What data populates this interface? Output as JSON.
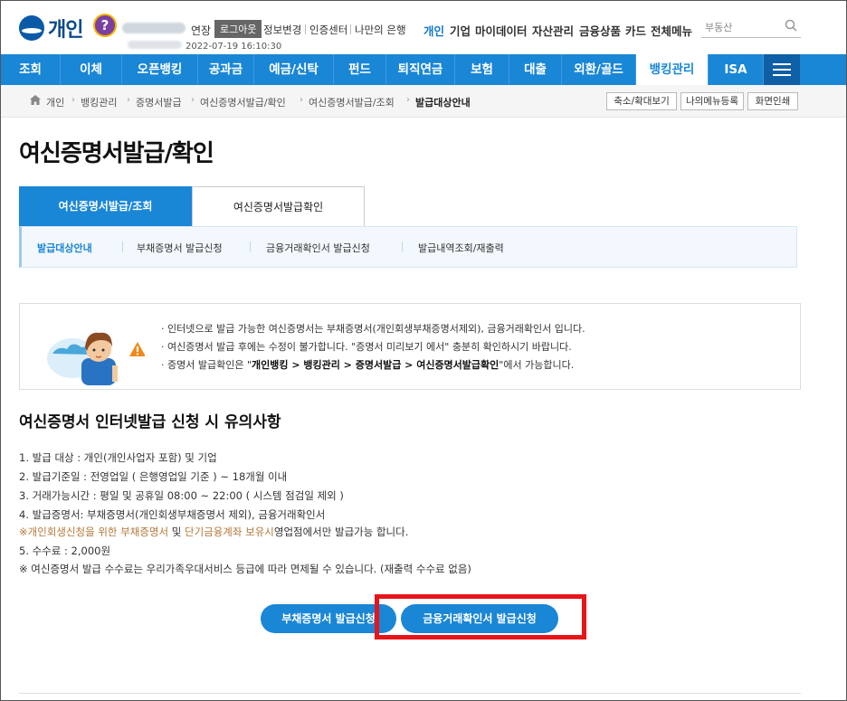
{
  "header": {
    "logo_text": "개인",
    "help_symbol": "?",
    "extend_label": "연장",
    "logout_label": "로그아웃",
    "util_links": [
      "정보변경",
      "인증센터",
      "나만의 은행"
    ],
    "login_time": "2022-07-19 16:10:30",
    "main_nav": [
      "개인",
      "기업",
      "마이데이터",
      "자산관리",
      "금융상품",
      "카드",
      "전체메뉴"
    ],
    "search_placeholder": "부동산"
  },
  "nav": {
    "items": [
      "조회",
      "이체",
      "오픈뱅킹",
      "공과금",
      "예금/신탁",
      "펀드",
      "퇴직연금",
      "보험",
      "대출",
      "외환/골드",
      "뱅킹관리",
      "ISA"
    ],
    "active_index": 10
  },
  "breadcrumb": {
    "items": [
      "개인",
      "뱅킹관리",
      "증명서발급",
      "여신증명서발급/확인",
      "여신증명서발급/조회",
      "발급대상안내"
    ],
    "buttons": [
      "축소/확대보기",
      "나의메뉴등록",
      "화면인쇄"
    ]
  },
  "page": {
    "title": "여신증명서발급/확인",
    "tabs": [
      "여신증명서발급/조회",
      "여신증명서발급확인"
    ],
    "subtabs": [
      "발급대상안내",
      "부채증명서 발급신청",
      "금융거래확인서 발급신청",
      "발급내역조회/재출력"
    ],
    "notice": {
      "line1": "인터넷으로 발급 가능한 여신증명서는 부채증명서(개인회생부채증명서제외), 금융거래확인서 입니다.",
      "line2": "여신증명서 발급 후에는 수정이 불가합니다. \"증명서 미리보기 에서\" 충분히 확인하시기 바랍니다.",
      "line3_prefix": "증명서 발급확인은 \"",
      "line3_bold": "개인뱅킹 > 뱅킹관리 > 증명서발급 > 여신증명서발급확인",
      "line3_suffix": "\"에서 가능합니다."
    },
    "section_title": "여신증명서 인터넷발급 신청 시 유의사항",
    "rules": {
      "r1": "1. 발급 대상 : 개인(개인사업자 포함) 및 기업",
      "r2": "2. 발급기준일 : 전영업일 ( 은행영업일 기준 ) ~ 18개월 이내",
      "r3": "3. 거래가능시간 : 평일 및 공휴일 08:00 ~ 22:00 ( 시스템 점검일 제외 )",
      "r4": "4. 발급증명서: 부채증명서(개인회생부채증명서 제외), 금융거래확인서",
      "r4_note_mark": "※",
      "r4_note_hl1": "개인회생신청을 위한 부채증명서",
      "r4_note_mid": " 및 ",
      "r4_note_hl2": "단기금융계좌 보유시",
      "r4_note_end": "영업점에서만 발급가능 합니다.",
      "r5": "5. 수수료 : 2,000원",
      "r6": "※ 여신증명서 발급 수수료는 우리가족우대서비스 등급에 따라 면제될 수 있습니다. (재출력 수수료 없음)"
    },
    "buttons": {
      "debt": "부채증명서 발급신청",
      "fin": "금융거래확인서 발급신청"
    }
  },
  "colors": {
    "primary": "#1a86d6",
    "highlight": "#e8141a",
    "note": "#b5783a"
  }
}
